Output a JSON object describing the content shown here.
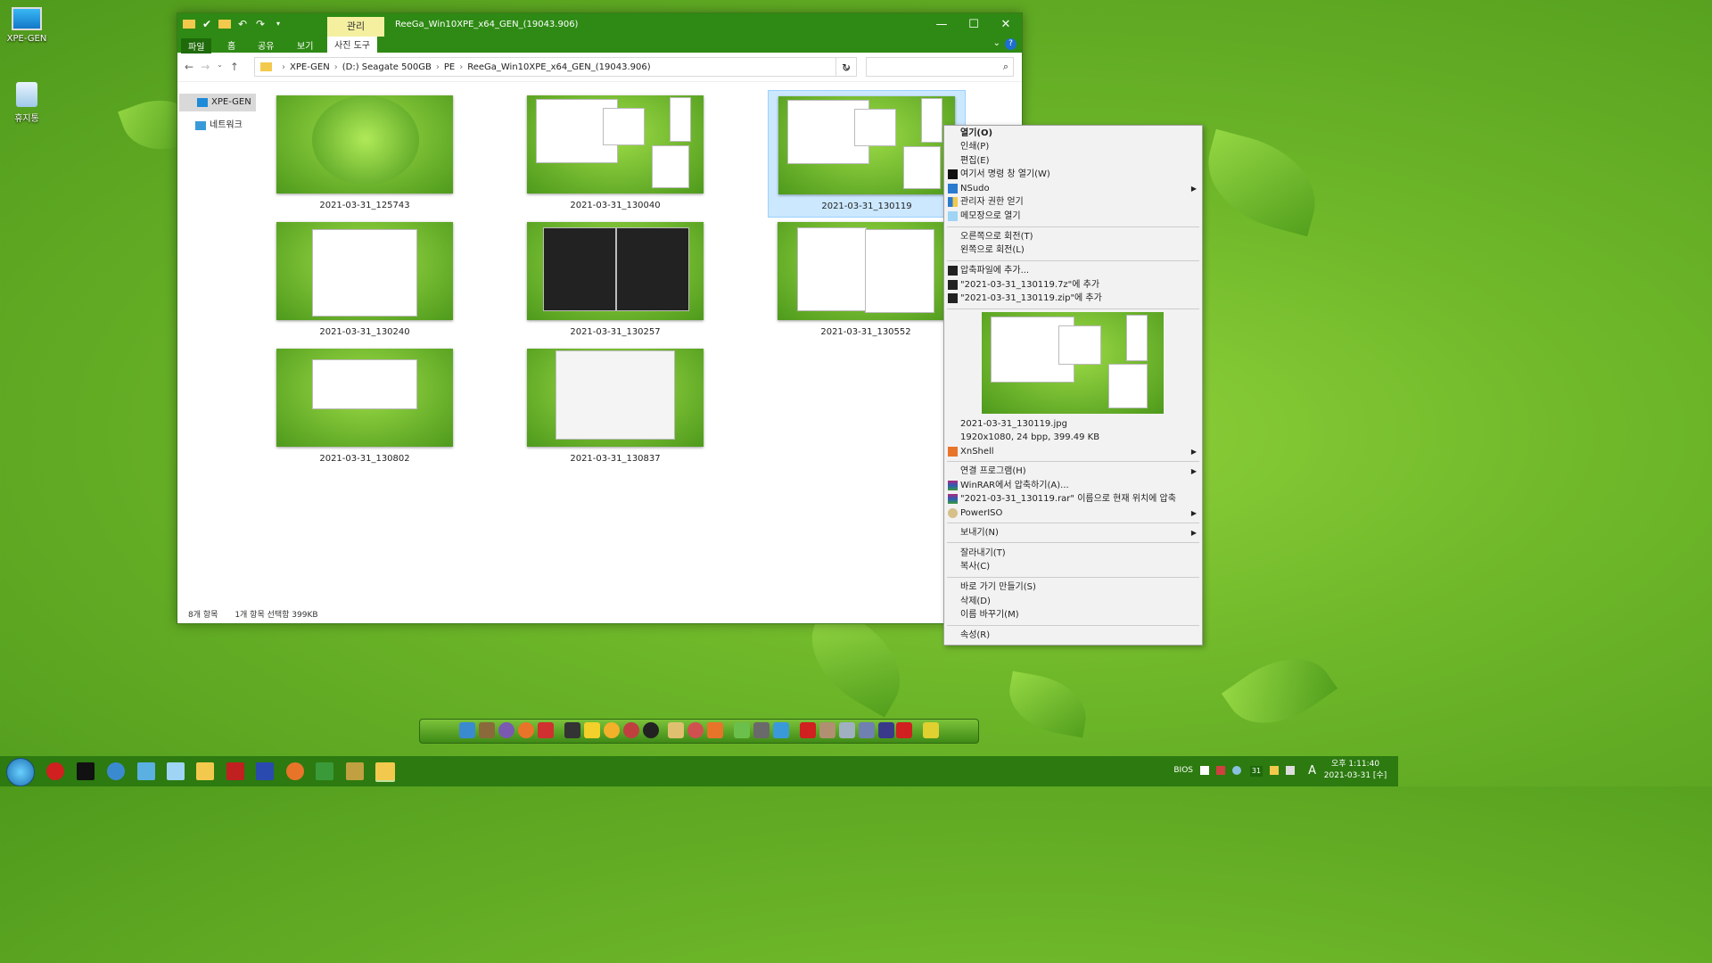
{
  "desktop": {
    "icons": [
      {
        "label": "XPE-GEN"
      },
      {
        "label": "휴지통"
      }
    ]
  },
  "window": {
    "title": "ReeGa_Win10XPE_x64_GEN_(19043.906)",
    "manage_tab": "관리",
    "ribbon_tabs": [
      "파일",
      "홈",
      "공유",
      "보기",
      "사진 도구"
    ],
    "help_label": "?",
    "address": {
      "parts": [
        "XPE-GEN",
        "(D:) Seagate 500GB",
        "PE",
        "ReeGa_Win10XPE_x64_GEN_(19043.906)"
      ]
    },
    "search_placeholder": "",
    "nav_items": [
      {
        "label": "XPE-GEN"
      },
      {
        "label": "네트워크"
      }
    ],
    "files": [
      {
        "name": "2021-03-31_125743"
      },
      {
        "name": "2021-03-31_130040"
      },
      {
        "name": "2021-03-31_130119"
      },
      {
        "name": "2021-03-31_130240"
      },
      {
        "name": "2021-03-31_130257"
      },
      {
        "name": "2021-03-31_130552"
      },
      {
        "name": "2021-03-31_130802"
      },
      {
        "name": "2021-03-31_130837"
      }
    ],
    "status_count": "8개 항목",
    "status_selected": "1개 항목 선택함 399KB"
  },
  "context_menu": {
    "items": [
      "열기(O)",
      "인쇄(P)",
      "편집(E)",
      "여기서 명령 창 열기(W)",
      "NSudo",
      "관리자 권한 얻기",
      "메모장으로 열기",
      "오른쪽으로 회전(T)",
      "왼쪽으로 회전(L)",
      "압축파일에 추가...",
      "\"2021-03-31_130119.7z\"에 추가",
      "\"2021-03-31_130119.zip\"에 추가",
      "2021-03-31_130119.jpg",
      "1920x1080, 24 bpp, 399.49 KB",
      "XnShell",
      "연결 프로그램(H)",
      "WinRAR에서 압축하기(A)...",
      "\"2021-03-31_130119.rar\" 이름으로 현재 위치에 압축",
      "PowerISO",
      "보내기(N)",
      "잘라내기(T)",
      "복사(C)",
      "바로 가기 만들기(S)",
      "삭제(D)",
      "이름 바꾸기(M)",
      "속성(R)"
    ]
  },
  "taskbar": {
    "tray_bios": "BIOS",
    "tray_badge": "31",
    "tray_lang": "A",
    "clock_time": "오후 1:11:40",
    "clock_date": "2021-03-31 [수]"
  },
  "colors": {
    "taskbar": "#2c7a10",
    "titlebar": "#2e8a14",
    "selection": "#cce8ff"
  }
}
